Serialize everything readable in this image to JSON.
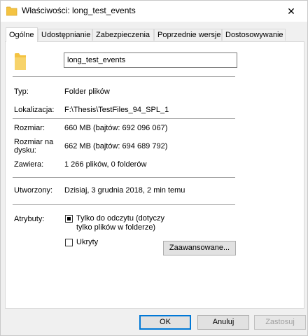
{
  "window": {
    "title": "Właściwości: long_test_events",
    "close_glyph": "✕"
  },
  "tabs": [
    {
      "label": "Ogólne",
      "active": true
    },
    {
      "label": "Udostępnianie"
    },
    {
      "label": "Zabezpieczenia"
    },
    {
      "label": "Poprzednie wersje"
    },
    {
      "label": "Dostosowywanie"
    }
  ],
  "general": {
    "name_value": "long_test_events",
    "type_label": "Typ:",
    "type_value": "Folder plików",
    "location_label": "Lokalizacja:",
    "location_value": "F:\\Thesis\\TestFiles_94_SPL_1",
    "size_label": "Rozmiar:",
    "size_value": "660 MB (bajtów: 692 096 067)",
    "size_on_disk_label_line1": "Rozmiar na",
    "size_on_disk_label_line2": "dysku:",
    "size_on_disk_value": "662 MB (bajtów: 694 689 792)",
    "contains_label": "Zawiera:",
    "contains_value": "1 266 plików, 0 folderów",
    "created_label": "Utworzony:",
    "created_value": "Dzisiaj, 3 grudnia 2018, 2 min temu",
    "attributes_label": "Atrybuty:",
    "readonly_label_line1": "Tylko do odczytu (dotyczy",
    "readonly_label_line2": "tylko plików w folderze)",
    "hidden_label": "Ukryty",
    "advanced_button": "Zaawansowane..."
  },
  "buttons": {
    "ok": "OK",
    "cancel": "Anuluj",
    "apply": "Zastosuj"
  },
  "colors": {
    "folder": "#f4c342",
    "accent": "#0078d7"
  },
  "icons": {
    "title": "folder-icon",
    "big": "folder-icon"
  }
}
